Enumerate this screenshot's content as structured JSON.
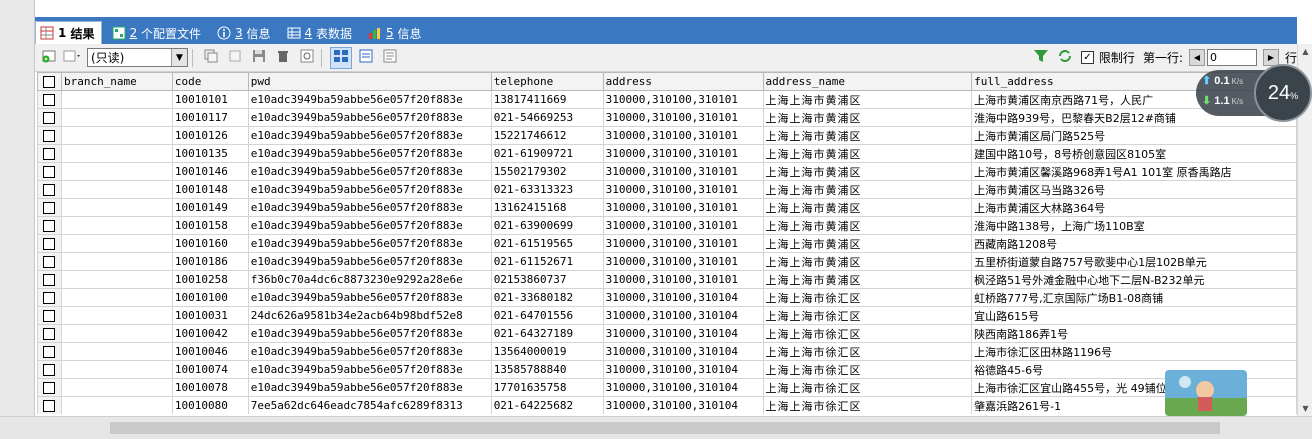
{
  "tabs": [
    {
      "num": "1",
      "label": "结果",
      "active": true
    },
    {
      "num": "2",
      "label": "个配置文件",
      "active": false
    },
    {
      "num": "3",
      "label": "信息",
      "active": false
    },
    {
      "num": "4",
      "label": "表数据",
      "active": false
    },
    {
      "num": "5",
      "label": "信息",
      "active": false
    }
  ],
  "toolbar": {
    "mode_select": "(只读)",
    "limit_label": "限制行",
    "first_row_label": "第一行:",
    "first_row_value": "0",
    "rows_label_truncated": "行"
  },
  "speed_widget": {
    "upload": "0.1",
    "upload_unit": "K/s",
    "download": "1.1",
    "download_unit": "K/s",
    "percent": "24",
    "percent_sign": "%"
  },
  "table": {
    "columns": [
      "branch_name",
      "code",
      "pwd",
      "telephone",
      "address",
      "address_name",
      "full_address"
    ],
    "rows": [
      [
        "",
        "10010101",
        "e10adc3949ba59abbe56e057f20f883e",
        "13817411669",
        "310000,310100,310101",
        "上海上海市黄浦区",
        "上海市黄浦区南京西路71号，人民广"
      ],
      [
        "",
        "10010117",
        "e10adc3949ba59abbe56e057f20f883e",
        "021-54669253",
        "310000,310100,310101",
        "上海上海市黄浦区",
        "淮海中路939号，巴黎春天B2层12#商铺"
      ],
      [
        "",
        "10010126",
        "e10adc3949ba59abbe56e057f20f883e",
        "15221746612",
        "310000,310100,310101",
        "上海上海市黄浦区",
        "上海市黄浦区局门路525号"
      ],
      [
        "",
        "10010135",
        "e10adc3949ba59abbe56e057f20f883e",
        "021-61909721",
        "310000,310100,310101",
        "上海上海市黄浦区",
        "建国中路10号，8号桥创意园区8105室"
      ],
      [
        "",
        "10010146",
        "e10adc3949ba59abbe56e057f20f883e",
        "15502179302",
        "310000,310100,310101",
        "上海上海市黄浦区",
        "上海市黄浦区馨溪路968弄1号A1 101室 原香禹路店"
      ],
      [
        "",
        "10010148",
        "e10adc3949ba59abbe56e057f20f883e",
        "021-63313323",
        "310000,310100,310101",
        "上海上海市黄浦区",
        "上海市黄浦区马当路326号"
      ],
      [
        "",
        "10010149",
        "e10adc3949ba59abbe56e057f20f883e",
        "13162415168",
        "310000,310100,310101",
        "上海上海市黄浦区",
        "上海市黄浦区大林路364号"
      ],
      [
        "",
        "10010158",
        "e10adc3949ba59abbe56e057f20f883e",
        "021-63900699",
        "310000,310100,310101",
        "上海上海市黄浦区",
        "淮海中路138号，上海广场110B室"
      ],
      [
        "",
        "10010160",
        "e10adc3949ba59abbe56e057f20f883e",
        "021-61519565",
        "310000,310100,310101",
        "上海上海市黄浦区",
        "西藏南路1208号"
      ],
      [
        "",
        "10010186",
        "e10adc3949ba59abbe56e057f20f883e",
        "021-61152671",
        "310000,310100,310101",
        "上海上海市黄浦区",
        "五里桥街道蒙自路757号歌斐中心1层102B单元"
      ],
      [
        "",
        "10010258",
        "f36b0c70a4dc6c8873230e9292a28e6e",
        "02153860737",
        "310000,310100,310101",
        "上海上海市黄浦区",
        "枫泾路51号外滩金融中心地下二层N-B232单元"
      ],
      [
        "",
        "10010100",
        "e10adc3949ba59abbe56e057f20f883e",
        "021-33680182",
        "310000,310100,310104",
        "上海上海市徐汇区",
        "虹桥路777号,汇京国际广场B1-08商铺"
      ],
      [
        "",
        "10010031",
        "24dc626a9581b34e2acb64b98bdf52e8",
        "021-64701556",
        "310000,310100,310104",
        "上海上海市徐汇区",
        "宜山路615号"
      ],
      [
        "",
        "10010042",
        "e10adc3949ba59abbe56e057f20f883e",
        "021-64327189",
        "310000,310100,310104",
        "上海上海市徐汇区",
        "陕西南路186弄1号"
      ],
      [
        "",
        "10010046",
        "e10adc3949ba59abbe56e057f20f883e",
        "13564000019",
        "310000,310100,310104",
        "上海上海市徐汇区",
        "上海市徐汇区田林路1196号"
      ],
      [
        "",
        "10010074",
        "e10adc3949ba59abbe56e057f20f883e",
        "13585788840",
        "310000,310100,310104",
        "上海上海市徐汇区",
        "裕德路45-6号"
      ],
      [
        "",
        "10010078",
        "e10adc3949ba59abbe56e057f20f883e",
        "17701635758",
        "310000,310100,310104",
        "上海上海市徐汇区",
        "上海市徐汇区宜山路455号，光        49铺位"
      ],
      [
        "",
        "10010080",
        "7ee5a62dc646eadc7854afc6289f8313",
        "021-64225682",
        "310000,310100,310104",
        "上海上海市徐汇区",
        "肇嘉浜路261号-1"
      ]
    ]
  }
}
